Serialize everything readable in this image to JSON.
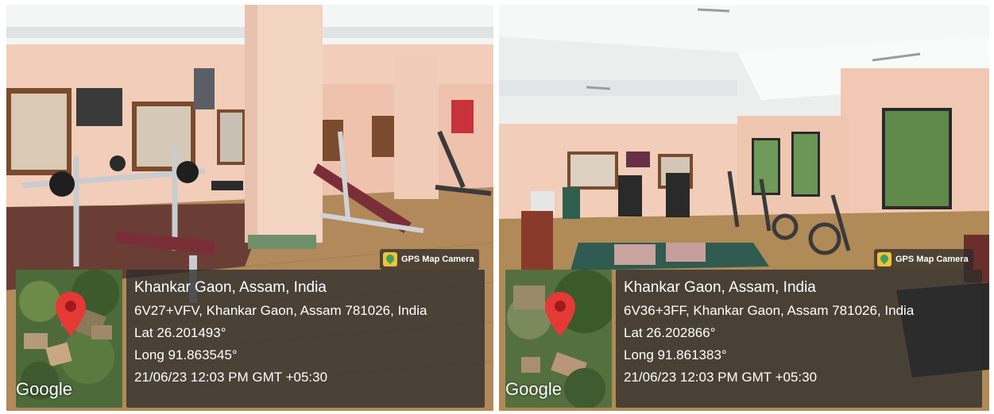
{
  "photos": [
    {
      "gps_badge": "GPS Map Camera",
      "location_title": "Khankar Gaon, Assam, India",
      "address": "6V27+VFV, Khankar Gaon, Assam 781026, India",
      "latitude": "Lat 26.201493°",
      "longitude": "Long 91.863545°",
      "timestamp": "21/06/23 12:03 PM GMT +05:30",
      "map_label": "Google"
    },
    {
      "gps_badge": "GPS Map Camera",
      "location_title": "Khankar Gaon, Assam, India",
      "address": "6V36+3FF, Khankar Gaon, Assam 781026, India",
      "latitude": "Lat 26.202866°",
      "longitude": "Long 91.861383°",
      "timestamp": "21/06/23 12:03 PM GMT +05:30",
      "map_label": "Google"
    }
  ],
  "colors": {
    "wall": "#f2cdb9",
    "ceiling": "#eef0ef",
    "floor": "#b08a57",
    "pin": "#e53935"
  }
}
